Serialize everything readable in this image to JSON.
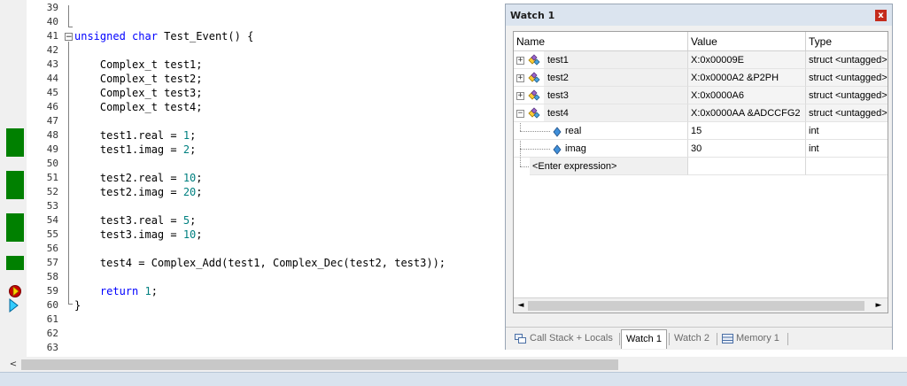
{
  "editor": {
    "line_numbers": [
      "39",
      "40",
      "41",
      "42",
      "43",
      "44",
      "45",
      "46",
      "47",
      "48",
      "49",
      "50",
      "51",
      "52",
      "53",
      "54",
      "55",
      "56",
      "57",
      "58",
      "59",
      "60",
      "61",
      "62",
      "63"
    ],
    "lines": [
      {
        "segments": []
      },
      {
        "segments": []
      },
      {
        "segments": [
          {
            "t": "unsigned char",
            "c": "kw"
          },
          {
            "t": " Test_Event() {",
            "c": ""
          }
        ]
      },
      {
        "segments": []
      },
      {
        "segments": [
          {
            "t": "    Complex_t test1;",
            "c": ""
          }
        ]
      },
      {
        "segments": [
          {
            "t": "    Complex_t test2;",
            "c": ""
          }
        ]
      },
      {
        "segments": [
          {
            "t": "    Complex_t test3;",
            "c": ""
          }
        ]
      },
      {
        "segments": [
          {
            "t": "    Complex_t test4;",
            "c": ""
          }
        ]
      },
      {
        "segments": []
      },
      {
        "segments": [
          {
            "t": "    test1.real = ",
            "c": ""
          },
          {
            "t": "1",
            "c": "num"
          },
          {
            "t": ";",
            "c": ""
          }
        ]
      },
      {
        "segments": [
          {
            "t": "    test1.imag = ",
            "c": ""
          },
          {
            "t": "2",
            "c": "num"
          },
          {
            "t": ";",
            "c": ""
          }
        ]
      },
      {
        "segments": []
      },
      {
        "segments": [
          {
            "t": "    test2.real = ",
            "c": ""
          },
          {
            "t": "10",
            "c": "num"
          },
          {
            "t": ";",
            "c": ""
          }
        ]
      },
      {
        "segments": [
          {
            "t": "    test2.imag = ",
            "c": ""
          },
          {
            "t": "20",
            "c": "num"
          },
          {
            "t": ";",
            "c": ""
          }
        ]
      },
      {
        "segments": []
      },
      {
        "segments": [
          {
            "t": "    test3.real = ",
            "c": ""
          },
          {
            "t": "5",
            "c": "num"
          },
          {
            "t": ";",
            "c": ""
          }
        ]
      },
      {
        "segments": [
          {
            "t": "    test3.imag = ",
            "c": ""
          },
          {
            "t": "10",
            "c": "num"
          },
          {
            "t": ";",
            "c": ""
          }
        ]
      },
      {
        "segments": []
      },
      {
        "segments": [
          {
            "t": "    test4 = Complex_Add(test1, Complex_Dec(test2, test3));",
            "c": ""
          }
        ]
      },
      {
        "segments": []
      },
      {
        "segments": [
          {
            "t": "    ",
            "c": ""
          },
          {
            "t": "return",
            "c": "kw"
          },
          {
            "t": " ",
            "c": ""
          },
          {
            "t": "1",
            "c": "num"
          },
          {
            "t": ";",
            "c": ""
          }
        ]
      },
      {
        "segments": [
          {
            "t": "}",
            "c": ""
          }
        ]
      },
      {
        "segments": []
      },
      {
        "segments": []
      },
      {
        "segments": []
      }
    ],
    "executed_lines": [
      "48",
      "49",
      "51",
      "52",
      "54",
      "55",
      "57"
    ],
    "breakpoint_line": "59",
    "current_line": "60",
    "colors": {
      "keyword": "#0000ff",
      "number": "#008080",
      "executed": "#008000"
    }
  },
  "watch": {
    "title": "Watch 1",
    "close_icon": "close-icon",
    "columns": [
      "Name",
      "Value",
      "Type"
    ],
    "rows": [
      {
        "name": "test1",
        "value": "X:0x00009E",
        "type": "struct <untagged>",
        "kind": "struct",
        "expanded": false
      },
      {
        "name": "test2",
        "value": "X:0x0000A2 &P2PH",
        "type": "struct <untagged>",
        "kind": "struct",
        "expanded": false
      },
      {
        "name": "test3",
        "value": "X:0x0000A6",
        "type": "struct <untagged>",
        "kind": "struct",
        "expanded": false
      },
      {
        "name": "test4",
        "value": "X:0x0000AA &ADCCFG2",
        "type": "struct <untagged>",
        "kind": "struct",
        "expanded": true
      },
      {
        "name": "real",
        "value": "15",
        "type": "int",
        "kind": "field"
      },
      {
        "name": "imag",
        "value": "30",
        "type": "int",
        "kind": "field"
      }
    ],
    "enter_expression": "<Enter expression>",
    "tabs": [
      "Call Stack + Locals",
      "Watch 1",
      "Watch 2",
      "Memory 1"
    ],
    "active_tab": "Watch 1"
  }
}
